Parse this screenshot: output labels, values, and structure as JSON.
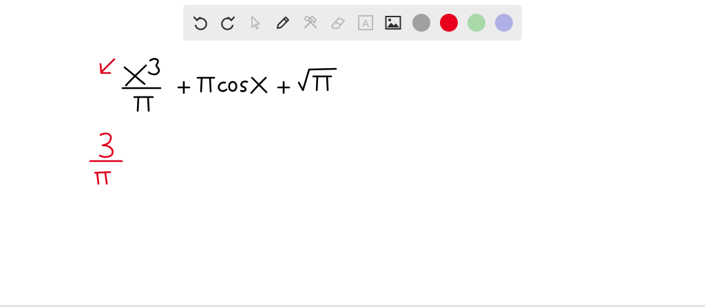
{
  "toolbar": {
    "tools": [
      {
        "name": "undo-icon",
        "interactable": true
      },
      {
        "name": "redo-icon",
        "interactable": true
      },
      {
        "name": "pointer-icon",
        "interactable": true
      },
      {
        "name": "pen-icon",
        "interactable": true
      },
      {
        "name": "tools-icon",
        "interactable": true
      },
      {
        "name": "eraser-icon",
        "interactable": true
      },
      {
        "name": "text-icon",
        "interactable": true
      },
      {
        "name": "image-icon",
        "interactable": true
      }
    ],
    "text_tool_glyph": "A",
    "colors": {
      "gray": "#a0a0a0",
      "red": "#e8001c",
      "green": "#a9d8a9",
      "purple": "#aeb0e6"
    }
  },
  "ink_colors": {
    "black": "#000000",
    "red": "#e0001b"
  }
}
